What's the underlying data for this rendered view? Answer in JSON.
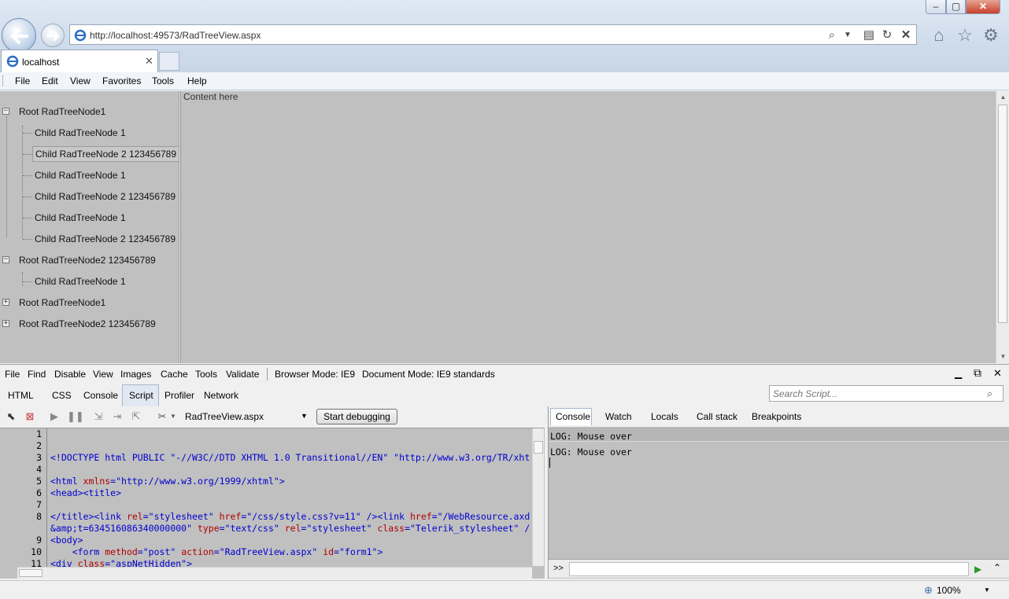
{
  "window": {
    "minimize": "–",
    "maximize": "▢",
    "close": "✕"
  },
  "address": {
    "url": "http://localhost:49573/RadTreeView.aspx"
  },
  "tabs": [
    {
      "label": "localhost",
      "close": "✕"
    }
  ],
  "menu": [
    "File",
    "Edit",
    "View",
    "Favorites",
    "Tools",
    "Help"
  ],
  "tree": {
    "nodes": [
      {
        "label": "Root RadTreeNode1",
        "level": 0,
        "toggle": "−"
      },
      {
        "label": "Child RadTreeNode 1",
        "level": 1
      },
      {
        "label": "Child RadTreeNode 2 123456789",
        "level": 1,
        "selected": true
      },
      {
        "label": "Child RadTreeNode 1",
        "level": 1
      },
      {
        "label": "Child RadTreeNode 2 123456789",
        "level": 1
      },
      {
        "label": "Child RadTreeNode 1",
        "level": 1
      },
      {
        "label": "Child RadTreeNode 2 123456789",
        "level": 1
      },
      {
        "label": "Root RadTreeNode2 123456789",
        "level": 0,
        "toggle": "−"
      },
      {
        "label": "Child RadTreeNode 1",
        "level": 1
      },
      {
        "label": "Root RadTreeNode1",
        "level": 0,
        "toggle": "+"
      },
      {
        "label": "Root RadTreeNode2 123456789",
        "level": 0,
        "toggle": "+"
      }
    ]
  },
  "content": {
    "text": "Content here"
  },
  "devtools": {
    "menu": [
      "File",
      "Find",
      "Disable",
      "View",
      "Images",
      "Cache",
      "Tools",
      "Validate"
    ],
    "browser_mode": "Browser Mode: IE9",
    "document_mode": "Document Mode: IE9 standards",
    "tabs": [
      "HTML",
      "CSS",
      "Console",
      "Script",
      "Profiler",
      "Network"
    ],
    "search_placeholder": "Search Script...",
    "file": "RadTreeView.aspx",
    "start_debugging": "Start debugging",
    "console_tabs": [
      "Console",
      "Watch",
      "Locals",
      "Call stack",
      "Breakpoints"
    ],
    "logs": [
      "LOG: Mouse over",
      "LOG: Mouse over"
    ],
    "console_prompt": ">>",
    "code": {
      "line_numbers": [
        "1",
        "2",
        "3",
        "4",
        "5",
        "6",
        "7",
        "8",
        "9",
        "10",
        "11"
      ],
      "l3": "<!DOCTYPE html PUBLIC \"-//W3C//DTD XHTML 1.0 Transitional//EN\" \"http://www.w3.org/TR/xht",
      "l5_tag": "<html ",
      "l5_attr": "xmlns",
      "l5_val": "=\"http://www.w3.org/1999/xhtml\"",
      "l5_end": ">",
      "l6": "<head><title>",
      "l8_a": "</title><link ",
      "l8_b": "rel",
      "l8_c": "=\"stylesheet\" ",
      "l8_d": "href",
      "l8_e": "=\"/css/style.css?v=11\" /><link ",
      "l8_f": "href",
      "l8_g": "=\"/WebResource.axd",
      "l8b_a": "&amp;t=634516086340000000\" ",
      "l8b_b": "type",
      "l8b_c": "=\"text/css\" ",
      "l8b_d": "rel",
      "l8b_e": "=\"stylesheet\" ",
      "l8b_f": "class",
      "l8b_g": "=\"Telerik_stylesheet\" /",
      "l9": "<body>",
      "l10_a": "    <form ",
      "l10_b": "method",
      "l10_c": "=\"post\" ",
      "l10_d": "action",
      "l10_e": "=\"RadTreeView.aspx\" ",
      "l10_f": "id",
      "l10_g": "=\"form1\">",
      "l11_a": "<div ",
      "l11_b": "class",
      "l11_c": "=\"aspNetHidden\">"
    }
  },
  "status": {
    "zoom": "100%"
  }
}
